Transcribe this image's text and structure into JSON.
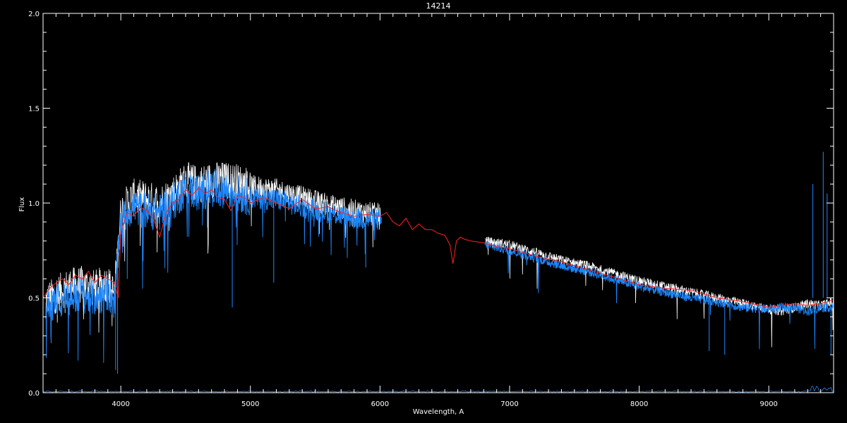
{
  "chart_data": {
    "type": "line",
    "title": "14214",
    "xlabel": "Wavelength, A",
    "ylabel": "Flux",
    "xlim": [
      3400,
      9500
    ],
    "ylim": [
      0.0,
      2.0
    ],
    "x_ticks": [
      4000,
      5000,
      6000,
      7000,
      8000,
      9000
    ],
    "x_tick_labels": [
      "4000",
      "5000",
      "6000",
      "7000",
      "8000",
      "9000"
    ],
    "y_ticks": [
      0.0,
      0.5,
      1.0,
      1.5,
      2.0
    ],
    "y_tick_labels": [
      "0.0",
      "0.5",
      "1.0",
      "1.5",
      "2.0"
    ],
    "grid": false,
    "series": [
      {
        "color": "#ffffff",
        "segments": [
          [
            3420,
            6010
          ],
          [
            6810,
            9500
          ]
        ],
        "x": [
          3420,
          3500,
          3600,
          3700,
          3800,
          3900,
          3950,
          4000,
          4050,
          4100,
          4200,
          4300,
          4400,
          4500,
          4600,
          4700,
          4800,
          4900,
          5000,
          5200,
          5400,
          5600,
          5800,
          6000,
          6810,
          7000,
          7200,
          7400,
          7600,
          7800,
          8000,
          8200,
          8400,
          8600,
          8800,
          9000,
          9100,
          9200,
          9300,
          9400,
          9500
        ],
        "y": [
          0.48,
          0.52,
          0.56,
          0.57,
          0.55,
          0.58,
          0.52,
          0.95,
          1.0,
          1.03,
          1.02,
          1.0,
          1.05,
          1.12,
          1.1,
          1.12,
          1.12,
          1.11,
          1.09,
          1.07,
          1.03,
          0.99,
          0.96,
          0.94,
          0.8,
          0.78,
          0.74,
          0.7,
          0.67,
          0.63,
          0.59,
          0.56,
          0.53,
          0.5,
          0.47,
          0.44,
          0.43,
          0.45,
          0.47,
          0.46,
          0.48
        ]
      },
      {
        "color": "#1e88ff",
        "segments": [
          [
            3420,
            6010
          ],
          [
            6810,
            9500
          ]
        ],
        "x": [
          3420,
          3500,
          3600,
          3700,
          3800,
          3900,
          3950,
          4000,
          4050,
          4100,
          4200,
          4300,
          4400,
          4500,
          4600,
          4700,
          4800,
          4900,
          5000,
          5200,
          5400,
          5600,
          5800,
          6000,
          6810,
          7000,
          7200,
          7400,
          7600,
          7800,
          8000,
          8200,
          8400,
          8600,
          8800,
          9000,
          9100,
          9200,
          9300,
          9400,
          9500
        ],
        "y": [
          0.45,
          0.48,
          0.5,
          0.52,
          0.5,
          0.53,
          0.48,
          0.9,
          0.96,
          0.98,
          0.96,
          0.95,
          1.0,
          1.08,
          1.05,
          1.08,
          1.07,
          1.05,
          1.03,
          1.02,
          0.98,
          0.95,
          0.92,
          0.91,
          0.78,
          0.75,
          0.71,
          0.67,
          0.64,
          0.6,
          0.56,
          0.53,
          0.5,
          0.48,
          0.45,
          0.44,
          0.45,
          0.45,
          0.43,
          0.45,
          0.45
        ]
      },
      {
        "color": "#ff2020",
        "x": [
          3400,
          3450,
          3500,
          3550,
          3600,
          3650,
          3700,
          3750,
          3800,
          3850,
          3900,
          3950,
          3980,
          4000,
          4050,
          4100,
          4150,
          4200,
          4250,
          4300,
          4350,
          4400,
          4450,
          4500,
          4550,
          4600,
          4650,
          4700,
          4750,
          4800,
          4850,
          4900,
          4950,
          5000,
          5100,
          5200,
          5300,
          5400,
          5500,
          5600,
          5700,
          5800,
          5900,
          6000,
          6050,
          6100,
          6150,
          6200,
          6250,
          6300,
          6350,
          6400,
          6450,
          6500,
          6540,
          6563,
          6590,
          6620,
          6650,
          6700,
          6800,
          6900,
          7000,
          7200,
          7400,
          7600,
          7800,
          8000,
          8200,
          8400,
          8600,
          8800,
          9000,
          9100,
          9200,
          9300,
          9400,
          9500
        ],
        "y": [
          0.5,
          0.55,
          0.58,
          0.6,
          0.57,
          0.62,
          0.6,
          0.64,
          0.58,
          0.62,
          0.6,
          0.58,
          0.5,
          0.85,
          0.95,
          0.93,
          0.98,
          0.96,
          0.92,
          0.82,
          0.95,
          1.0,
          1.02,
          1.07,
          1.04,
          1.08,
          1.05,
          1.07,
          1.03,
          1.02,
          0.96,
          1.04,
          1.03,
          1.0,
          1.03,
          1.0,
          0.97,
          1.02,
          0.97,
          0.98,
          0.95,
          0.93,
          0.94,
          0.93,
          0.95,
          0.9,
          0.88,
          0.92,
          0.86,
          0.89,
          0.86,
          0.86,
          0.84,
          0.83,
          0.78,
          0.68,
          0.8,
          0.82,
          0.81,
          0.8,
          0.79,
          0.77,
          0.76,
          0.72,
          0.69,
          0.65,
          0.61,
          0.57,
          0.55,
          0.54,
          0.5,
          0.48,
          0.45,
          0.46,
          0.47,
          0.46,
          0.47,
          0.49
        ]
      }
    ]
  }
}
